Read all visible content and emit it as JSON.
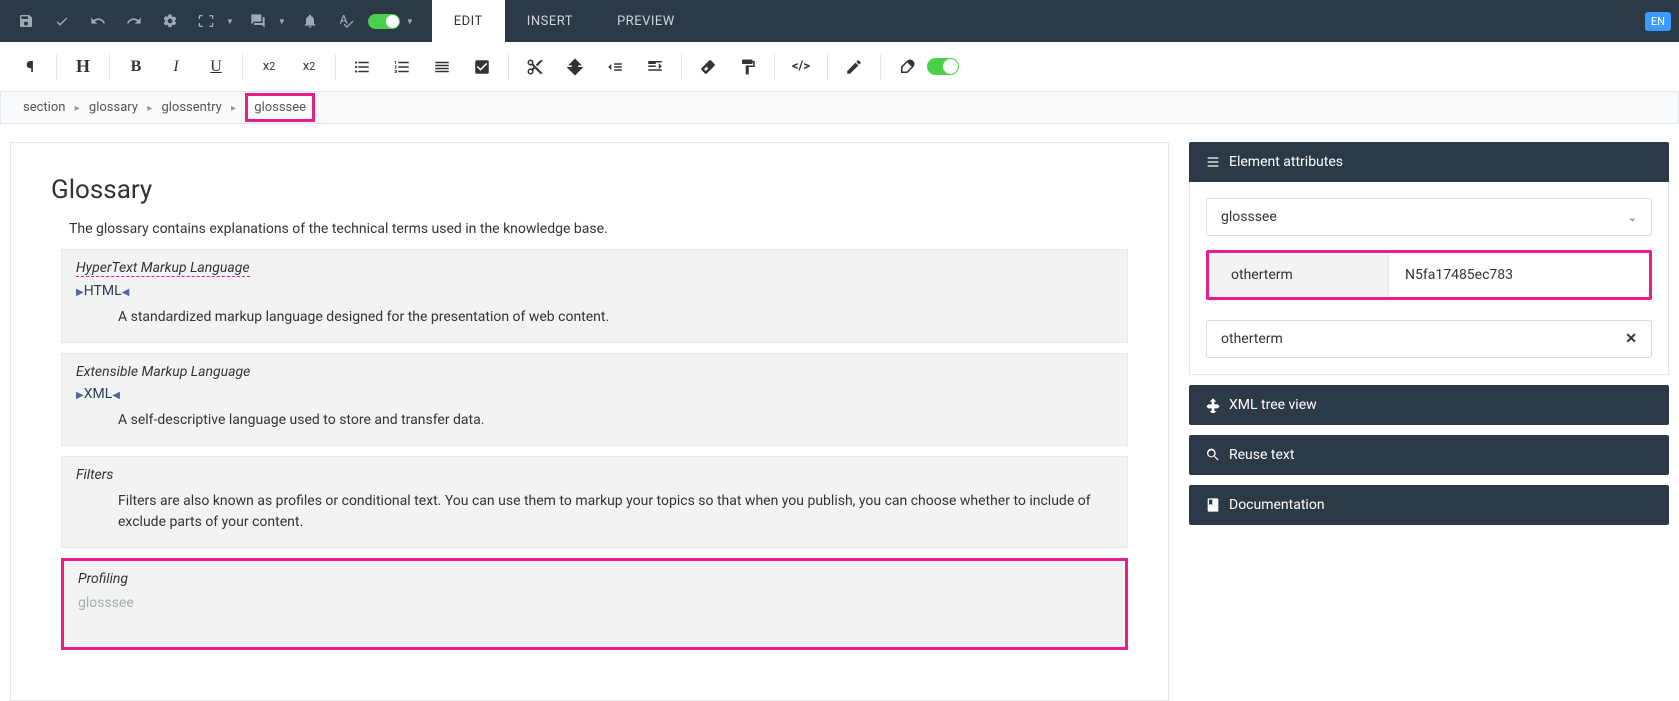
{
  "toolbar": {
    "tabs": {
      "edit": "EDIT",
      "insert": "INSERT",
      "preview": "PREVIEW"
    },
    "lang": "EN"
  },
  "breadcrumb": {
    "items": [
      "section",
      "glossary",
      "glossentry",
      "glosssee"
    ]
  },
  "editor": {
    "title": "Glossary",
    "intro": "The glossary contains explanations of the technical terms used in the knowledge base.",
    "entries": [
      {
        "term": "HyperText Markup Language",
        "acronym": "HTML",
        "def": "A standardized markup language designed for the presentation of web content."
      },
      {
        "term": "Extensible Markup Language",
        "acronym": "XML",
        "def": "A self-descriptive language used to store and transfer data."
      },
      {
        "term": "Filters",
        "acronym": "",
        "def": "Filters are also known as profiles or conditional text. You can use them to markup your topics so that when you publish, you can choose whether to include of exclude parts of your content."
      },
      {
        "term": "Profiling",
        "acronym": "",
        "def": "",
        "placeholder": "glosssee"
      }
    ]
  },
  "sidebar": {
    "panel_title": "Element attributes",
    "selected_element": "glosssee",
    "attr_key": "otherterm",
    "attr_val": "N5fa17485ec783",
    "input_value": "otherterm",
    "accordion1": "XML tree view",
    "accordion2": "Reuse text",
    "accordion3": "Documentation"
  }
}
